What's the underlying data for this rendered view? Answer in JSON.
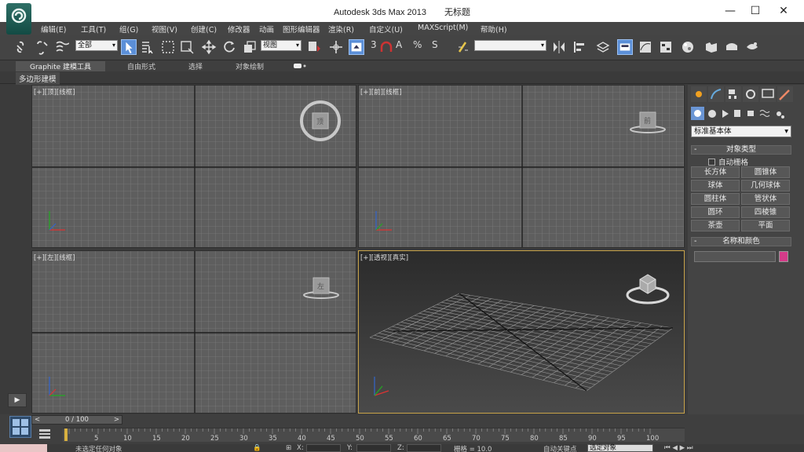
{
  "window": {
    "app_name": "Autodesk 3ds Max  2013",
    "doc_title": "无标题",
    "minimize": "—",
    "maximize": "☐",
    "close": "✕"
  },
  "menu": [
    "编辑(E)",
    "工具(T)",
    "组(G)",
    "视图(V)",
    "创建(C)",
    "修改器",
    "动画",
    "图形编辑器",
    "渲染(R)",
    "自定义(U)",
    "MAXScript(M)",
    "帮助(H)"
  ],
  "toolbar": {
    "selection_filter": "全部",
    "reference_coord": "视图",
    "named_selection": "",
    "snap_3": "3",
    "angle_snap": "A",
    "percent_snap": "%",
    "spinner_snap": "S"
  },
  "ribbon": {
    "tabs": [
      "Graphite 建模工具",
      "自由形式",
      "选择",
      "对象绘制"
    ],
    "sub_label": "多边形建模"
  },
  "viewports": {
    "top": "[+][顶][线框]",
    "front": "[+][前][线框]",
    "left": "[+][左][线框]",
    "persp": "[+][透视][真实]",
    "top_cube": "顶",
    "front_cube": "前",
    "left_cube": "左"
  },
  "command_panel": {
    "category": "标准基本体",
    "object_type_title": "对象类型",
    "autogrid": "自动栅格",
    "buttons": [
      "长方体",
      "圆锥体",
      "球体",
      "几何球体",
      "圆柱体",
      "管状体",
      "圆环",
      "四棱锥",
      "茶壶",
      "平面"
    ],
    "name_color_title": "名称和颜色",
    "swatch_color": "#d43b89"
  },
  "timeline": {
    "frame_display": "0 / 100",
    "prev": "<",
    "next": ">",
    "ticks": [
      "5",
      "10",
      "15",
      "20",
      "25",
      "30",
      "35",
      "40",
      "45",
      "50",
      "55",
      "60",
      "65",
      "70",
      "75",
      "80",
      "85",
      "90",
      "95",
      "100"
    ]
  },
  "status": {
    "selection": "未选定任何对象",
    "x": "X:",
    "y": "Y:",
    "z": "Z:",
    "grid": "栅格 = 10.0",
    "autokey": "自动关键点",
    "selected": "选定对象"
  }
}
